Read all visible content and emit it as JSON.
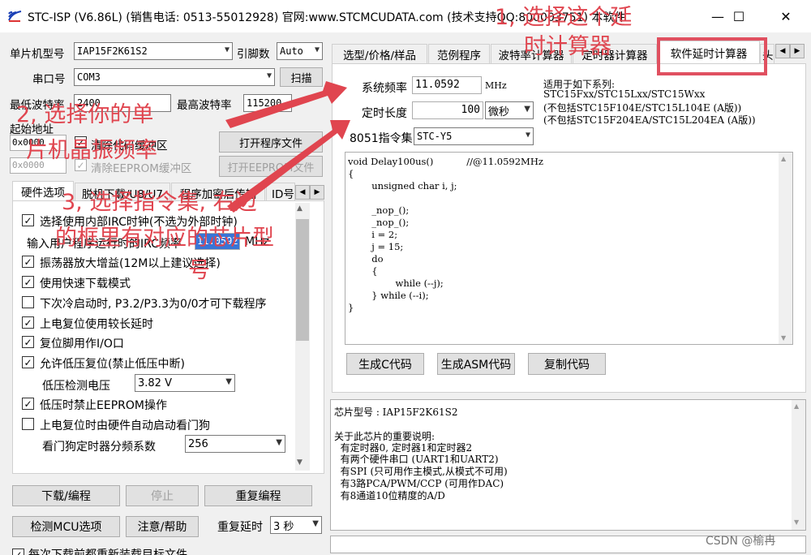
{
  "window": {
    "title": "STC-ISP (V6.86L) (销售电话: 0513-55012928) 官网:www.STCMCUDATA.com  (技术支持QQ:800003751) 本软件",
    "minimize_glyph": "—",
    "maximize_glyph": "☐",
    "close_glyph": "✕"
  },
  "left": {
    "mcu_label": "单片机型号",
    "mcu_value": "IAP15F2K61S2",
    "pins_label": "引脚数",
    "pins_value": "Auto",
    "port_label": "串口号",
    "port_value": "COM3",
    "scan_button": "扫描",
    "min_baud_label": "最低波特率",
    "min_baud_value": "2400",
    "max_baud_label": "最高波特率",
    "max_baud_value": "115200",
    "start_addr_label": "起始地址",
    "addr1": "0x0000",
    "clear_code_label": "清除代码缓冲区",
    "open_prog_button": "打开程序文件",
    "addr2": "0x0000",
    "clear_eeprom_label": "清除EEPROM缓冲区",
    "open_eeprom_button": "打开EEPROM文件",
    "tabs": [
      "硬件选项",
      "脱机下载/U8/U7",
      "程序加密后传输",
      "ID号"
    ],
    "options": [
      {
        "label": "选择使用内部IRC时钟(不选为外部时钟)",
        "checked": true
      },
      {
        "label": "振荡器放大增益(12M以上建议选择)",
        "checked": true
      },
      {
        "label": "使用快速下载模式",
        "checked": true
      },
      {
        "label": "下次冷启动时, P3.2/P3.3为0/0才可下载程序",
        "checked": false
      },
      {
        "label": "上电复位使用较长延时",
        "checked": true
      },
      {
        "label": "复位脚用作I/O口",
        "checked": true
      },
      {
        "label": "允许低压复位(禁止低压中断)",
        "checked": true
      },
      {
        "label": "低压时禁止EEPROM操作",
        "checked": true
      },
      {
        "label": "上电复位时由硬件自动启动看门狗",
        "checked": false
      }
    ],
    "freq_input_label": "输入用户程序运行时的IRC频率",
    "freq_input_value": "11.0592",
    "freq_unit": "MHz",
    "lvd_label": "低压检测电压",
    "lvd_value": "3.82 V",
    "wdt_label": "看门狗定时器分频系数",
    "wdt_value": "256",
    "download_button": "下载/编程",
    "stop_button": "停止",
    "reprogram_button": "重复编程",
    "check_mcu_button": "检测MCU选项",
    "help_button": "注意/帮助",
    "repeat_delay_label": "重复延时",
    "repeat_delay_value": "3 秒",
    "reload_label": "每次下载前都重新装载目标文件"
  },
  "right": {
    "tabs": [
      "选型/价格/样品",
      "范例程序",
      "波特率计算器",
      "定时器计算器",
      "软件延时计算器",
      "头"
    ],
    "sys_freq_label": "系统频率",
    "sys_freq_value": "11.0592",
    "sys_freq_unit": "MHz",
    "time_label": "定时长度",
    "time_value": "100",
    "time_unit": "微秒",
    "isa_label": "8051指令集",
    "isa_value": "STC-Y5",
    "series_lines": [
      "适用于如下系列:",
      "STC15Fxx/STC15Lxx/STC15Wxx",
      "(不包括STC15F104E/STC15L104E (A版))",
      "(不包括STC15F204EA/STC15L204EA (A版))"
    ],
    "code_lines": [
      "void Delay100us()\t\t//@11.0592MHz",
      "{",
      "\tunsigned char i, j;",
      "",
      "\t_nop_();",
      "\t_nop_();",
      "\ti = 2;",
      "\tj = 15;",
      "\tdo",
      "\t{",
      "\t\twhile (--j);",
      "\t} while (--i);",
      "}"
    ],
    "gen_c_button": "生成C代码",
    "gen_asm_button": "生成ASM代码",
    "copy_button": "复制代码",
    "info_lines": [
      "芯片型号 : IAP15F2K61S2",
      "",
      "关于此芯片的重要说明:",
      "  有定时器0, 定时器1和定时器2",
      "  有两个硬件串口 (UART1和UART2)",
      "  有SPI (只可用作主模式,从模式不可用)",
      "  有3路PCA/PWM/CCP (可用作DAC)",
      "  有8通道10位精度的A/D"
    ]
  },
  "annotations": {
    "a1_line1": "1, 选择这个延",
    "a1_line2": "时计算器",
    "a2_line1": "2, 选择你的单",
    "a2_line2": "片机晶振频率",
    "a3_line1": "3, 选择指令集, 右边",
    "a3_line2": "的框里有对应的芯片型",
    "a3_line3": "号",
    "color": "#e0454f"
  },
  "watermark": "CSDN @榆冉"
}
